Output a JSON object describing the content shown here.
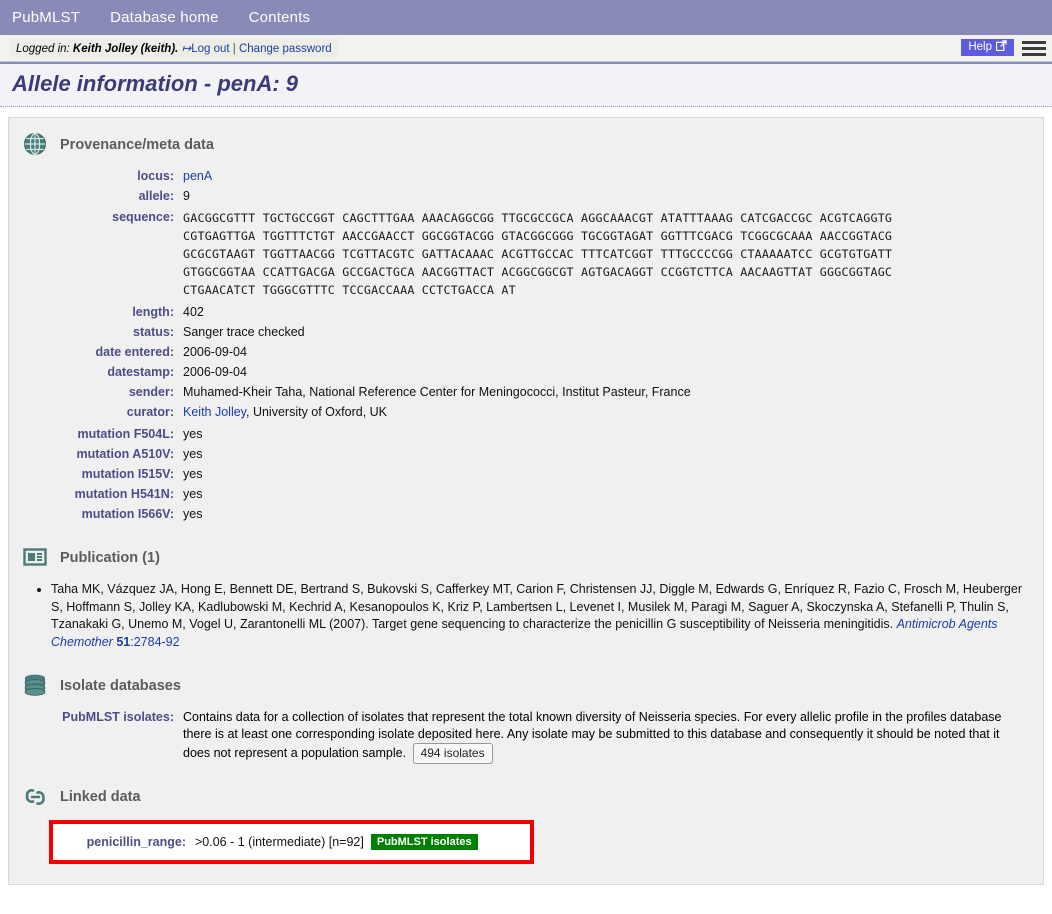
{
  "topnav": {
    "items": [
      {
        "label": "PubMLST",
        "name": "nav-pubmlst"
      },
      {
        "label": "Database home",
        "name": "nav-database-home"
      },
      {
        "label": "Contents",
        "name": "nav-contents"
      }
    ]
  },
  "loginbar": {
    "prefix": "Logged in:",
    "user": "Keith Jolley (keith).",
    "logout": "Log out",
    "separator": "|",
    "change_password": "Change password",
    "help": "Help"
  },
  "page": {
    "title": "Allele information - penA: 9"
  },
  "provenance": {
    "heading": "Provenance/meta data",
    "icon": "globe-icon",
    "fields": [
      {
        "label": "locus:",
        "value": "penA",
        "link": true
      },
      {
        "label": "allele:",
        "value": "9",
        "link": false
      }
    ],
    "sequence_label": "sequence:",
    "sequence_lines": [
      "GACGGCGTTT TGCTGCCGGT CAGCTTTGAA AAACAGGCGG TTGCGCCGCA AGGCAAACGT ATATTTAAAG CATCGACCGC ACGTCAGGTG",
      "CGTGAGTTGA TGGTTTCTGT AACCGAACCT GGCGGTACGG GTACGGCGGG TGCGGTAGAT GGTTTCGACG TCGGCGCAAA AACCGGTACG",
      "GCGCGTAAGT TGGTTAACGG TCGTTACGTC GATTACAAAC ACGTTGCCAC TTTCATCGGT TTTGCCCCGG CTAAAAATCC GCGTGTGATT",
      "GTGGCGGTAA CCATTGACGA GCCGACTGCA AACGGTTACT ACGGCGGCGT AGTGACAGGT CCGGTCTTCA AACAAGTTAT GGGCGGTAGC",
      "CTGAACATCT TGGGCGTTTC TCCGACCAAA CCTCTGACCA AT"
    ],
    "meta": [
      {
        "label": "length:",
        "value": "402"
      },
      {
        "label": "status:",
        "value": "Sanger trace checked"
      },
      {
        "label": "date entered:",
        "value": "2006-09-04"
      },
      {
        "label": "datestamp:",
        "value": "2006-09-04"
      },
      {
        "label": "sender:",
        "value": "Muhamed-Kheir Taha, National Reference Center for Meningococci, Institut Pasteur, France"
      }
    ],
    "curator_label": "curator:",
    "curator_link": "Keith Jolley",
    "curator_rest": ", University of Oxford, UK",
    "mutations": [
      {
        "label": "mutation F504L:",
        "value": "yes"
      },
      {
        "label": "mutation A510V:",
        "value": "yes"
      },
      {
        "label": "mutation I515V:",
        "value": "yes"
      },
      {
        "label": "mutation H541N:",
        "value": "yes"
      },
      {
        "label": "mutation I566V:",
        "value": "yes"
      }
    ]
  },
  "publication": {
    "heading": "Publication (1)",
    "icon": "article-icon",
    "citation_text": "Taha MK, Vázquez JA, Hong E, Bennett DE, Bertrand S, Bukovski S, Cafferkey MT, Carion F, Christensen JJ, Diggle M, Edwards G, Enríquez R, Fazio C, Frosch M, Heuberger S, Hoffmann S, Jolley KA, Kadlubowski M, Kechrid A, Kesanopoulos K, Kriz P, Lambertsen L, Levenet I, Musilek M, Paragi M, Saguer A, Skoczynska A, Stefanelli P, Thulin S, Tzanakaki G, Unemo M, Vogel U, Zarantonelli ML (2007). Target gene sequencing to characterize the penicillin G susceptibility of Neisseria meningitidis. ",
    "journal": "Antimicrob Agents Chemother",
    "volume": "51",
    "pages": ":2784-92"
  },
  "isolate_databases": {
    "heading": "Isolate databases",
    "icon": "database-icon",
    "label": "PubMLST isolates:",
    "description": "Contains data for a collection of isolates that represent the total known diversity of Neisseria species. For every allelic profile in the profiles database there is at least one corresponding isolate deposited here. Any isolate may be submitted to this database and consequently it should be noted that it does not represent a population sample.",
    "count_button": "494 isolates"
  },
  "linked_data": {
    "heading": "Linked data",
    "icon": "link-icon",
    "label": "penicillin_range:",
    "value": ">0.06 - 1 (intermediate) [n=92]",
    "badge": "PubMLST isolates",
    "highlight_color": "#f40000",
    "badge_color": "#008000"
  }
}
